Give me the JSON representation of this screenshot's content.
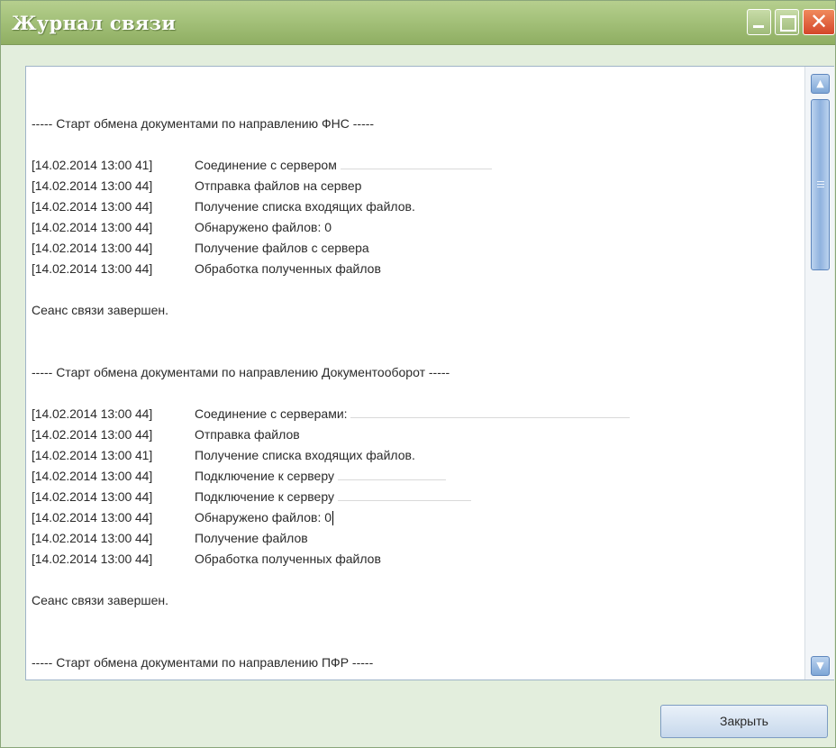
{
  "window": {
    "title": "Журнал связи"
  },
  "log": {
    "sections": [
      {
        "header": "----- Старт обмена документами по направлению ФНС -----",
        "lines": [
          {
            "ts": "[14.02.2014 13:00 41]",
            "text": "Соединение с сервером "
          },
          {
            "ts": "[14.02.2014 13:00 44]",
            "text": "Отправка файлов на сервер"
          },
          {
            "ts": "[14.02.2014 13:00 44]",
            "text": "Получение списка входящих файлов."
          },
          {
            "ts": "[14.02.2014 13:00 44]",
            "text": "Обнаружено файлов: 0"
          },
          {
            "ts": "[14.02.2014 13:00 44]",
            "text": "Получение файлов с сервера"
          },
          {
            "ts": "[14.02.2014 13:00 44]",
            "text": "Обработка полученных файлов"
          }
        ],
        "footer": "Сеанс связи завершен."
      },
      {
        "header": "----- Старт обмена документами по направлению Документооборот -----",
        "lines": [
          {
            "ts": "[14.02.2014 13:00 44]",
            "text": "Соединение с серверами: "
          },
          {
            "ts": "[14.02.2014 13:00 44]",
            "text": "Отправка файлов"
          },
          {
            "ts": "[14.02.2014 13:00 41]",
            "text": "Получение списка входящих файлов."
          },
          {
            "ts": "[14.02.2014 13:00 44]",
            "text": "Подключение к серверу "
          },
          {
            "ts": "[14.02.2014 13:00 44]",
            "text": "Подключение к серверу "
          },
          {
            "ts": "[14.02.2014 13:00 44]",
            "text": "Обнаружено файлов: 0"
          },
          {
            "ts": "[14.02.2014 13:00 44]",
            "text": "Получение файлов"
          },
          {
            "ts": "[14.02.2014 13:00 44]",
            "text": "Обработка полученных файлов"
          }
        ],
        "footer": "Сеанс связи завершен."
      },
      {
        "header": "----- Старт обмена документами по направлению ПФР -----"
      }
    ]
  },
  "footer": {
    "close_label": "Закрыть"
  },
  "colors": {
    "titlebar": "#a4c17a",
    "window_bg": "#e3eedd",
    "scrollbar": "#8fb2de"
  }
}
